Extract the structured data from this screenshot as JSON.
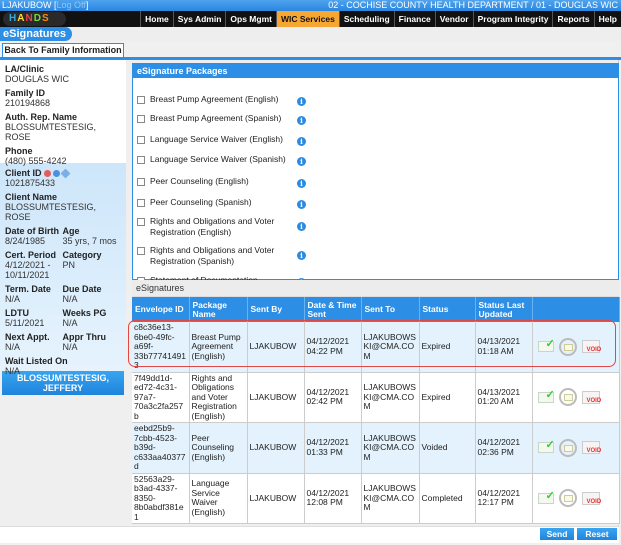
{
  "header": {
    "username": "LJAKUBOW",
    "logoff": "Log Off",
    "department": "02 - COCHISE COUNTY HEALTH DEPARTMENT / 01 - DOUGLAS WIC",
    "logo": [
      "H",
      "A",
      "N",
      "D",
      "S"
    ]
  },
  "menu": [
    {
      "label": "Home",
      "active": false
    },
    {
      "label": "Sys Admin",
      "active": false
    },
    {
      "label": "Ops Mgmt",
      "active": false
    },
    {
      "label": "WIC Services",
      "active": true
    },
    {
      "label": "Scheduling",
      "active": false
    },
    {
      "label": "Finance",
      "active": false
    },
    {
      "label": "Vendor",
      "active": false
    },
    {
      "label": "Program Integrity",
      "active": false
    },
    {
      "label": "Reports",
      "active": false
    },
    {
      "label": "Help",
      "active": false
    }
  ],
  "page": {
    "title": "eSignatures",
    "back_button": "Back To Family Information"
  },
  "family": {
    "la_clinic_label": "LA/Clinic",
    "la_clinic": "DOUGLAS WIC",
    "family_id_label": "Family ID",
    "family_id": "210194868",
    "auth_rep_label": "Auth. Rep. Name",
    "auth_rep": "BLOSSUMTESTESIG, ROSE",
    "phone_label": "Phone",
    "phone": "(480) 555-4242"
  },
  "client": {
    "client_id_label": "Client ID",
    "client_id": "1021875433",
    "client_name_label": "Client Name",
    "client_name": "BLOSSUMTESTESIG, ROSE",
    "dob_label": "Date of Birth",
    "dob": "8/24/1985",
    "age_label": "Age",
    "age": "35 yrs, 7 mos",
    "cert_label": "Cert. Period",
    "cert": "4/12/2021 - 10/11/2021",
    "category_label": "Category",
    "category": "PN",
    "term_label": "Term. Date",
    "term": "N/A",
    "due_label": "Due Date",
    "due": "N/A",
    "ldtu_label": "LDTU",
    "ldtu": "5/11/2021",
    "weeks_label": "Weeks PG",
    "weeks": "N/A",
    "next_appt_label": "Next Appt.",
    "next_appt": "N/A",
    "appr_thru_label": "Appr Thru",
    "appr_thru": "N/A",
    "wait_label": "Wait Listed On",
    "wait": "N/A",
    "other_member": "BLOSSUMTESTESIG, JEFFERY"
  },
  "packages": {
    "title": "eSignature Packages",
    "items": [
      {
        "name": "Breast Pump Agreement (English)",
        "checked": false
      },
      {
        "name": "Breast Pump Agreement (Spanish)",
        "checked": false
      },
      {
        "name": "Language Service Waiver (English)",
        "checked": false
      },
      {
        "name": "Language Service Waiver (Spanish)",
        "checked": false
      },
      {
        "name": "Peer Counseling (English)",
        "checked": false
      },
      {
        "name": "Peer Counseling (Spanish)",
        "checked": false
      },
      {
        "name": "Rights and Obligations and Voter Registration (English)",
        "checked": false
      },
      {
        "name": "Rights and Obligations and Voter Registration (Spanish)",
        "checked": false
      },
      {
        "name": "Statement of Documentation",
        "checked": false
      }
    ]
  },
  "esignatures": {
    "title": "eSignatures",
    "columns": [
      "Envelope ID",
      "Package Name",
      "Sent By",
      "Date & Time Sent",
      "Sent To",
      "Status",
      "Status Last Updated",
      ""
    ],
    "rows": [
      {
        "envelope_id": "c8c36e13-6be0-49fc-a69f-33b777414913",
        "package": "Breast Pump Agreement (English)",
        "sent_by": "LJAKUBOW",
        "sent": "04/12/2021 04:22 PM",
        "sent_to": "LJAKUBOWSKI@CMA.COM",
        "status": "Expired",
        "updated": "04/13/2021 01:18 AM",
        "highlighted": true
      },
      {
        "envelope_id": "7f49dd1d-ed72-4c31-97a7-70a3c2fa257b",
        "package": "Rights and Obligations and Voter Registration (English)",
        "sent_by": "LJAKUBOW",
        "sent": "04/12/2021 02:42 PM",
        "sent_to": "LJAKUBOWSKI@CMA.COM",
        "status": "Expired",
        "updated": "04/13/2021 01:20 AM",
        "highlighted": false
      },
      {
        "envelope_id": "eebd25b9-7cbb-4523-b39d-c633aa40377d",
        "package": "Peer Counseling (English)",
        "sent_by": "LJAKUBOW",
        "sent": "04/12/2021 01:33 PM",
        "sent_to": "LJAKUBOWSKI@CMA.COM",
        "status": "Voided",
        "updated": "04/12/2021 02:36 PM",
        "highlighted": false
      },
      {
        "envelope_id": "52563a29-b3ad-4337-8350-8b0abdf381e1",
        "package": "Language Service Waiver (English)",
        "sent_by": "LJAKUBOW",
        "sent": "04/12/2021 12:08 PM",
        "sent_to": "LJAKUBOWSKI@CMA.COM",
        "status": "Completed",
        "updated": "04/12/2021 12:17 PM",
        "highlighted": false
      }
    ],
    "actions": {
      "view_icon": "envelope-check-icon",
      "resend_icon": "envelope-refresh-icon",
      "void_icon": "envelope-void-icon",
      "void_text": "VOID"
    }
  },
  "buttons": {
    "send": "Send",
    "reset": "Reset"
  }
}
